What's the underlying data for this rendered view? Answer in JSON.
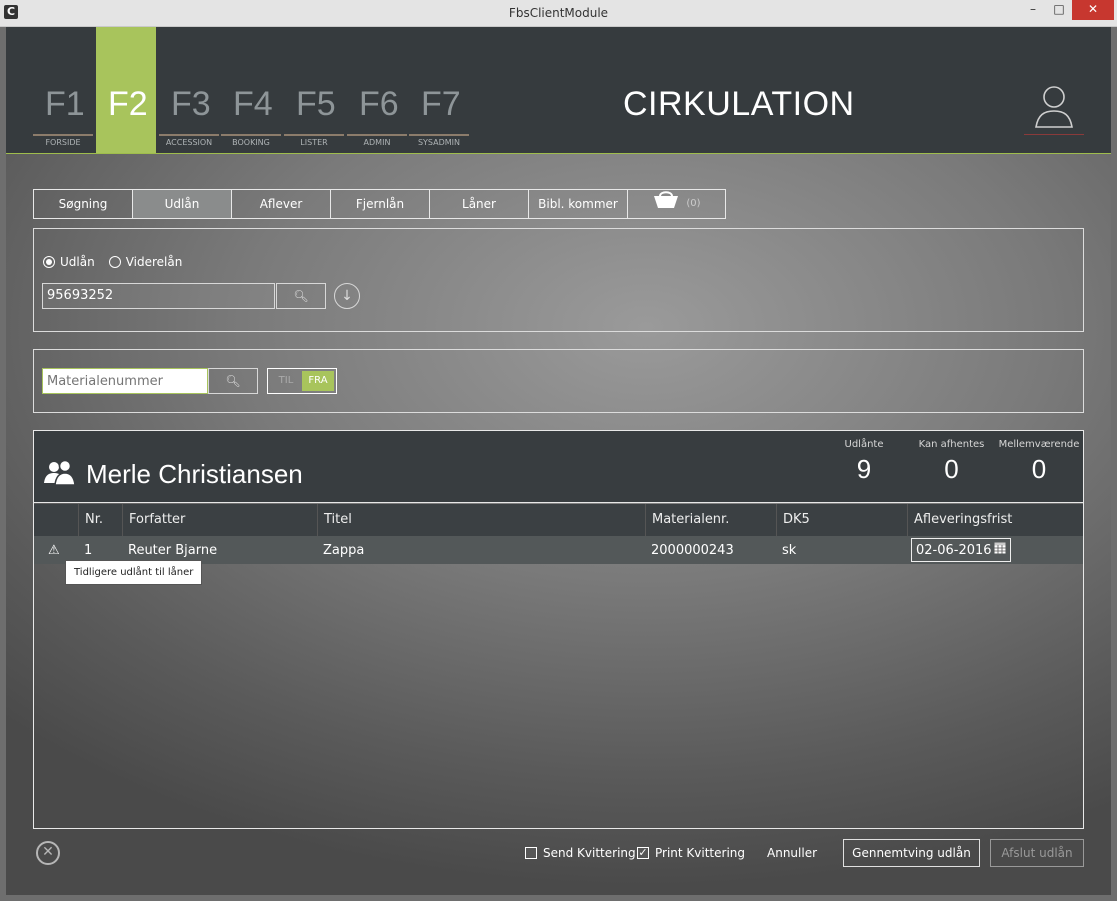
{
  "window": {
    "title": "FbsClientModule",
    "app_icon": "C",
    "minimize": "–",
    "maximize": "□",
    "close": "✕"
  },
  "header": {
    "fkeys": [
      {
        "key": "F1",
        "label": "FORSIDE"
      },
      {
        "key": "F2",
        "label": ""
      },
      {
        "key": "F3",
        "label": "ACCESSION"
      },
      {
        "key": "F4",
        "label": "BOOKING"
      },
      {
        "key": "F5",
        "label": "LISTER"
      },
      {
        "key": "F6",
        "label": "ADMIN"
      },
      {
        "key": "F7",
        "label": "SYSADMIN"
      }
    ],
    "active_key": "F2",
    "title": "CIRKULATION",
    "accent_color": "#a8c45c"
  },
  "tabs": [
    {
      "label": "Søgning"
    },
    {
      "label": "Udlån"
    },
    {
      "label": "Aflever"
    },
    {
      "label": "Fjernlån"
    },
    {
      "label": "Låner"
    },
    {
      "label": "Bibl. kommer"
    }
  ],
  "active_tab": "Udlån",
  "basket": {
    "icon": "basket-icon",
    "count": "(0)"
  },
  "loan_panel": {
    "radio_udlaan": "Udlån",
    "radio_viderelaan": "Viderelån",
    "selected_radio": "Udlån",
    "borrower_input_value": "95693252"
  },
  "material_panel": {
    "placeholder": "Materialenummer",
    "toggle_til": "TIL",
    "toggle_fra": "FRA",
    "toggle_selected": "FRA"
  },
  "borrower": {
    "name": "Merle Christiansen",
    "stats": [
      {
        "label": "Udlånte",
        "value": "9"
      },
      {
        "label": "Kan afhentes",
        "value": "0"
      },
      {
        "label": "Mellemværende",
        "value": "0"
      }
    ]
  },
  "table": {
    "columns": [
      "",
      "Nr.",
      "Forfatter",
      "Titel",
      "Materialenr.",
      "DK5",
      "Afleveringsfrist"
    ],
    "rows": [
      {
        "warning": "⚠",
        "nr": "1",
        "forfatter": "Reuter Bjarne",
        "titel": "Zappa",
        "materialenr": "2000000243",
        "dk5": "sk",
        "frist": "02-06-2016"
      }
    ],
    "tooltip": "Tidligere udlånt til låner"
  },
  "footer": {
    "send_kvittering": "Send Kvittering",
    "send_checked": false,
    "print_kvittering": "Print Kvittering",
    "print_checked": true,
    "annuller": "Annuller",
    "gennemtving": "Gennemtving udlån",
    "afslut": "Afslut udlån"
  }
}
